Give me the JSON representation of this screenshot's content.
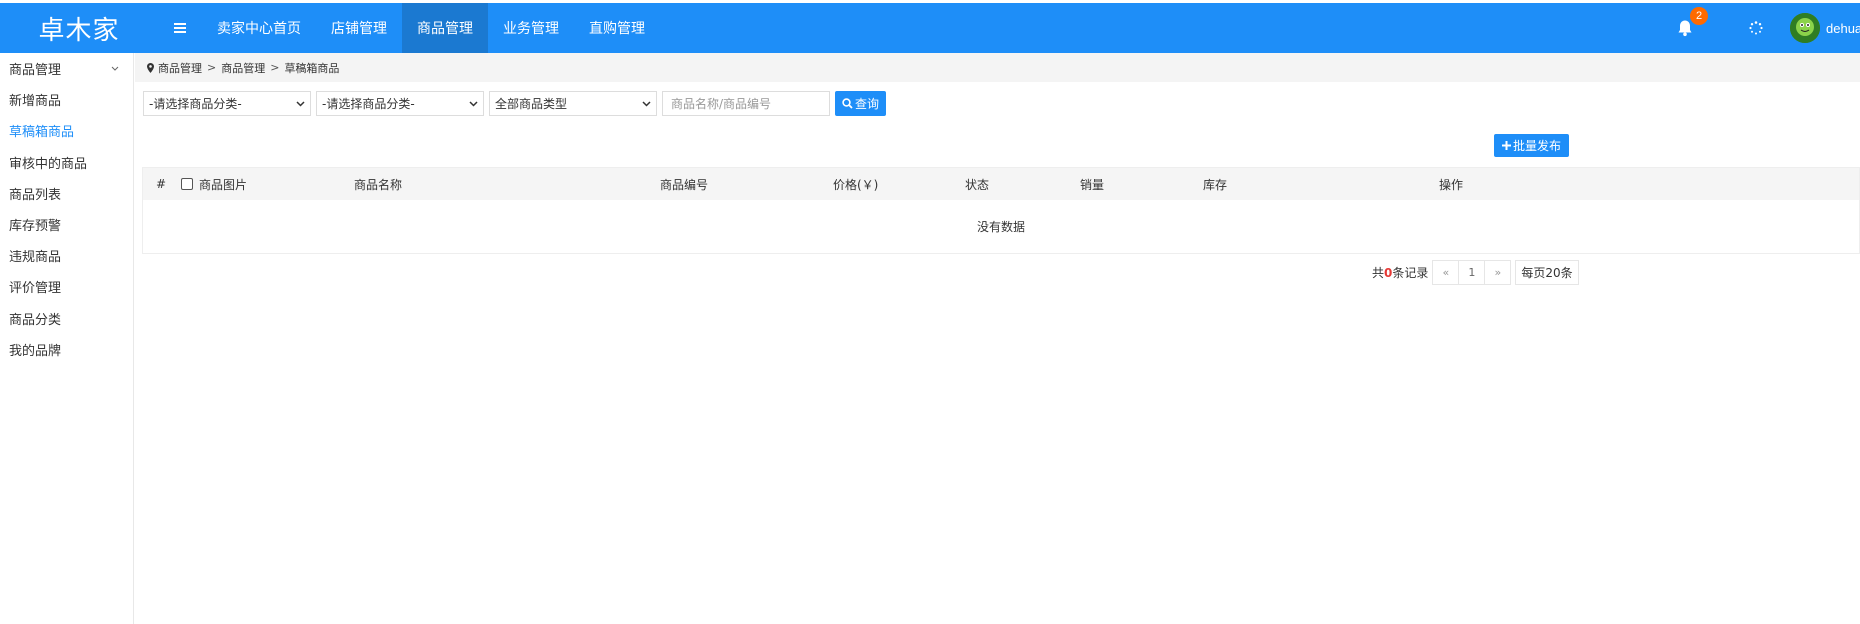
{
  "brand": "卓木家",
  "nav": [
    {
      "label": "卖家中心首页"
    },
    {
      "label": "店铺管理"
    },
    {
      "label": "商品管理"
    },
    {
      "label": "业务管理"
    },
    {
      "label": "直购管理"
    }
  ],
  "active_nav": "商品管理",
  "notification_count": "2",
  "username": "dehuang",
  "sidebar": {
    "group_label": "商品管理",
    "items": [
      {
        "label": "新增商品"
      },
      {
        "label": "草稿箱商品"
      },
      {
        "label": "审核中的商品"
      },
      {
        "label": "商品列表"
      },
      {
        "label": "库存预警"
      },
      {
        "label": "违规商品"
      },
      {
        "label": "评价管理"
      },
      {
        "label": "商品分类"
      },
      {
        "label": "我的品牌"
      }
    ],
    "active_item": "草稿箱商品"
  },
  "breadcrumb": [
    "商品管理",
    "商品管理",
    "草稿箱商品"
  ],
  "breadcrumb_sep": ">",
  "filters": {
    "category1": "-请选择商品分类-",
    "category2": "-请选择商品分类-",
    "type": "全部商品类型",
    "search_placeholder": "商品名称/商品编号",
    "query_label": "查询"
  },
  "batch_publish_label": "批量发布",
  "table": {
    "columns": [
      "#",
      "商品图片",
      "商品名称",
      "商品编号",
      "价格(￥)",
      "状态",
      "销量",
      "库存",
      "操作"
    ],
    "empty_text": "没有数据"
  },
  "pagination": {
    "total_prefix": "共",
    "total_count": "0",
    "total_suffix": "条记录",
    "prev": "«",
    "current_page": "1",
    "next": "»",
    "per_page": "每页20条"
  },
  "colors": {
    "primary": "#1e8ef8",
    "nav_active": "#1b79d1",
    "badge": "#ff6a00",
    "total_count": "#e53935"
  }
}
